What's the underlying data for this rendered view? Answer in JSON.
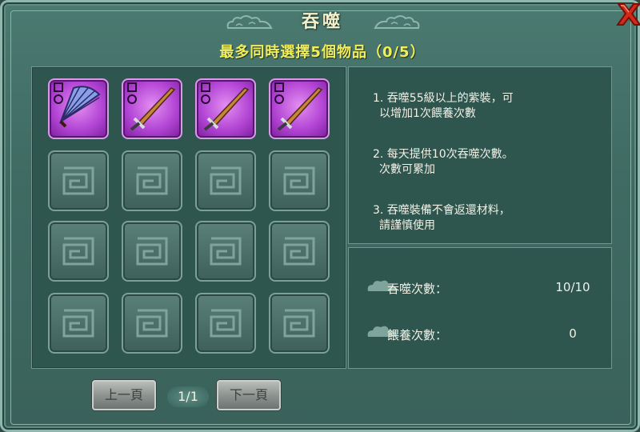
{
  "window": {
    "title": "吞噬",
    "subtitle": "最多同時選擇5個物品（0/5）",
    "close_icon": "close-x-icon"
  },
  "items": [
    {
      "slot": 1,
      "type": "purple-fan",
      "icon": "fan-weapon-icon",
      "rarity": "purple"
    },
    {
      "slot": 2,
      "type": "purple-sword",
      "icon": "sword-weapon-icon",
      "rarity": "purple"
    },
    {
      "slot": 3,
      "type": "purple-sword",
      "icon": "sword-weapon-icon",
      "rarity": "purple"
    },
    {
      "slot": 4,
      "type": "purple-sword",
      "icon": "sword-weapon-icon",
      "rarity": "purple"
    }
  ],
  "grid": {
    "columns": 4,
    "rows": 4
  },
  "info": {
    "line1a": "1. 吞噬55級以上的紫裝，可",
    "line1b": "以增加1次餵養次數",
    "line2a": "2. 每天提供10次吞噬次數。",
    "line2b": "次數可累加",
    "line3a": "3. 吞噬裝備不會返還材料，",
    "line3b": "請謹慎使用"
  },
  "stats": {
    "devour_label": "吞噬次數：",
    "devour_value": "10/10",
    "feed_label": "餵養次數：",
    "feed_value": "0"
  },
  "pagination": {
    "prev_label": "上一頁",
    "page": "1/1",
    "next_label": "下一頁"
  },
  "colors": {
    "panel_bg": "#2f554f",
    "rarity_purple": "#b447d6",
    "subtitle": "#f2ee5a"
  }
}
